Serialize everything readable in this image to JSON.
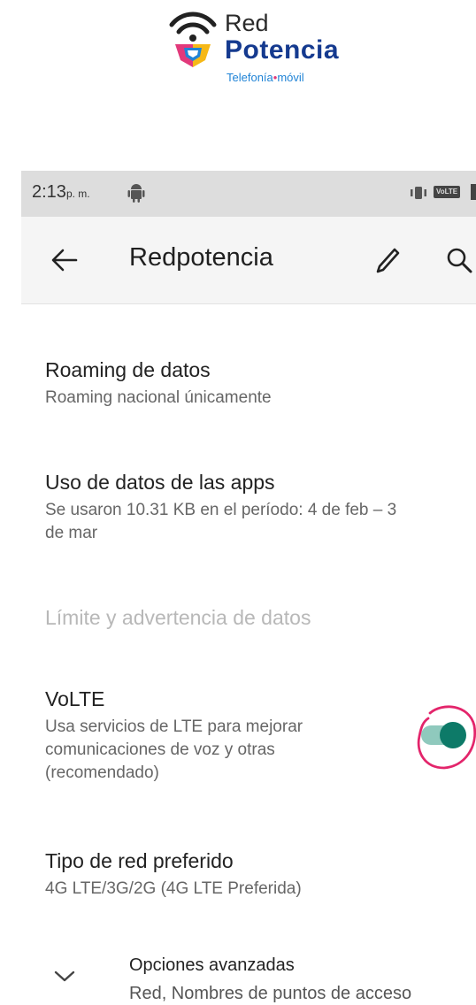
{
  "logo": {
    "line1": "Red",
    "line2": "Potencia",
    "tag_left": "Telefonía",
    "tag_dot": "•",
    "tag_right": "móvil",
    "colors": {
      "blue": "#153a8f",
      "tag": "#1f83d6",
      "pink": "#e2397b",
      "yellow": "#f6b817"
    }
  },
  "status_bar": {
    "time": "2:13",
    "ampm": "p. m.",
    "badge": "VoLTE"
  },
  "app_bar": {
    "title": "Redpotencia",
    "icons": [
      "back-arrow-icon",
      "pencil-icon",
      "search-icon"
    ]
  },
  "settings": {
    "roaming": {
      "title": "Roaming de datos",
      "summary": "Roaming nacional únicamente"
    },
    "app_usage": {
      "title": "Uso de datos de las apps",
      "summary_line1": "Se usaron 10.31 KB en el período: 4 de feb – 3",
      "summary_line2": "de mar"
    },
    "limit": {
      "title": "Límite y advertencia de datos"
    },
    "volte": {
      "title": "VoLTE",
      "summary_line1": "Usa servicios de LTE para mejorar",
      "summary_line2": "comunicaciones de voz y otras",
      "summary_line3": "(recomendado)",
      "enabled": true
    },
    "network_type": {
      "title": "Tipo de red preferido",
      "summary": "4G LTE/3G/2G (4G LTE Preferida)"
    },
    "advanced": {
      "title": "Opciones avanzadas",
      "summary": "Red, Nombres de puntos de acceso"
    }
  },
  "colors": {
    "toggle_on": "#0d7a68",
    "toggle_track": "#8fc9bd",
    "highlight_circle": "#e3256b",
    "appbar_bg": "#f5f5f5",
    "status_bg": "#dddddd"
  }
}
